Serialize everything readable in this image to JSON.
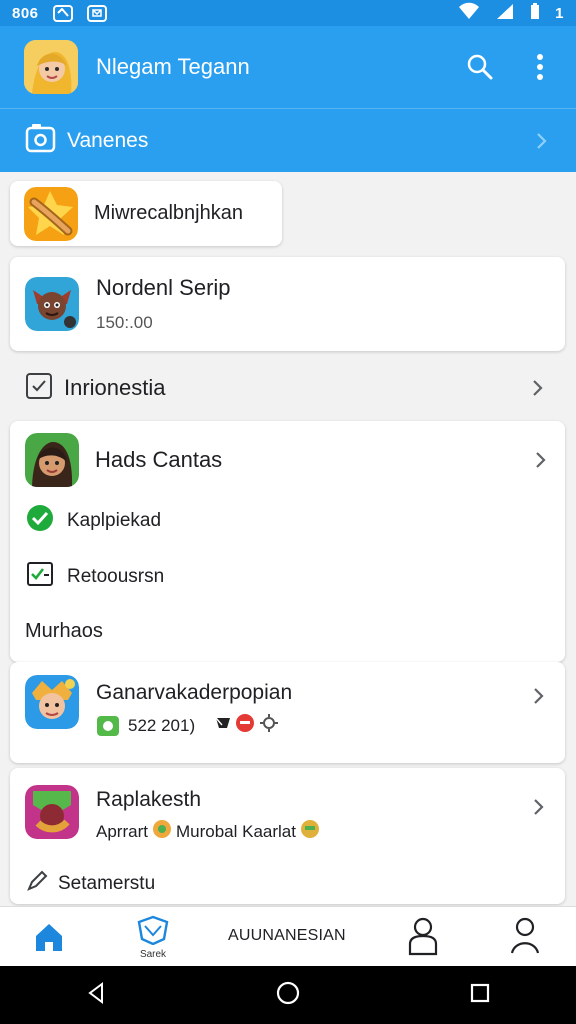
{
  "status_bar": {
    "left_text": "806",
    "right_text": "1"
  },
  "app_bar": {
    "title": "Nlegam Tegann",
    "search_icon": "search-icon",
    "more_icon": "more-vert-icon"
  },
  "sub_header": {
    "label": "Vanenes"
  },
  "cards": {
    "first_title": "Miwrecalbnjhkan",
    "second_title": "Nordenl Serip",
    "second_value": "150:.00"
  },
  "section": {
    "label": "Inrionestia"
  },
  "hads_card": {
    "title": "Hads Cantas",
    "status": "Kaplpiekad",
    "action": "Retoousrsn"
  },
  "section_heading": "Murhaos",
  "game_card": {
    "title": "Ganarvakaderpopian",
    "value": "522 201)"
  },
  "final_card": {
    "title": "Raplakesth",
    "detail_left": "Aprrart",
    "detail_right": "Murobal Kaarlat",
    "footer": "Setamerstu"
  },
  "bottom_nav": {
    "tab_2_label": "Sarek",
    "center_label": "AUUNANESIAN"
  },
  "colors": {
    "header": "#2A9FF0",
    "status_bar": "#1D8FE3",
    "success": "#1EAB3C",
    "icon_blue": "#1C87DD"
  }
}
